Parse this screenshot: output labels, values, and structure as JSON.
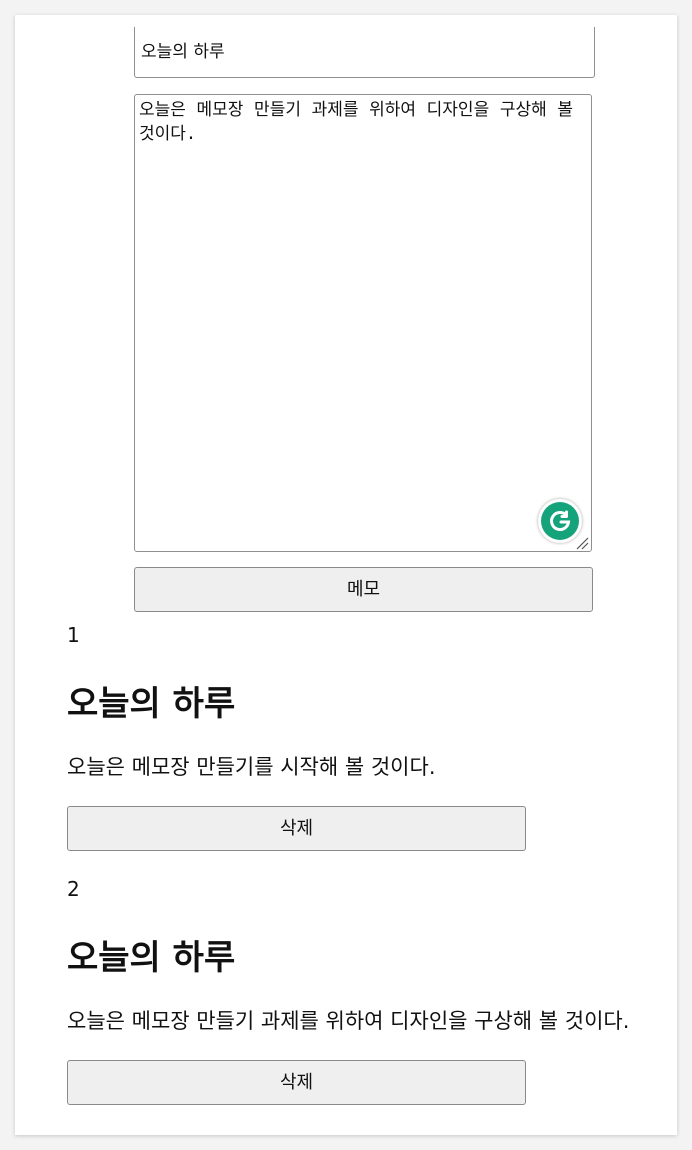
{
  "form": {
    "title_value": "오늘의 하루",
    "content_value": "오늘은 메모장 만들기 과제를 위하여 디자인을 구상해 볼 것이다.",
    "submit_label": "메모"
  },
  "memos": [
    {
      "index": "1",
      "title": "오늘의 하루",
      "content": "오늘은 메모장 만들기를 시작해 볼 것이다.",
      "delete_label": "삭제"
    },
    {
      "index": "2",
      "title": "오늘의 하루",
      "content": "오늘은 메모장 만들기 과제를 위하여 디자인을 구상해 볼 것이다.",
      "delete_label": "삭제"
    }
  ],
  "colors": {
    "grammarly_green": "#15a37c",
    "button_bg": "#efefef"
  },
  "icons": {
    "grammarly": "grammarly-icon",
    "resize": "resize-handle-icon"
  }
}
